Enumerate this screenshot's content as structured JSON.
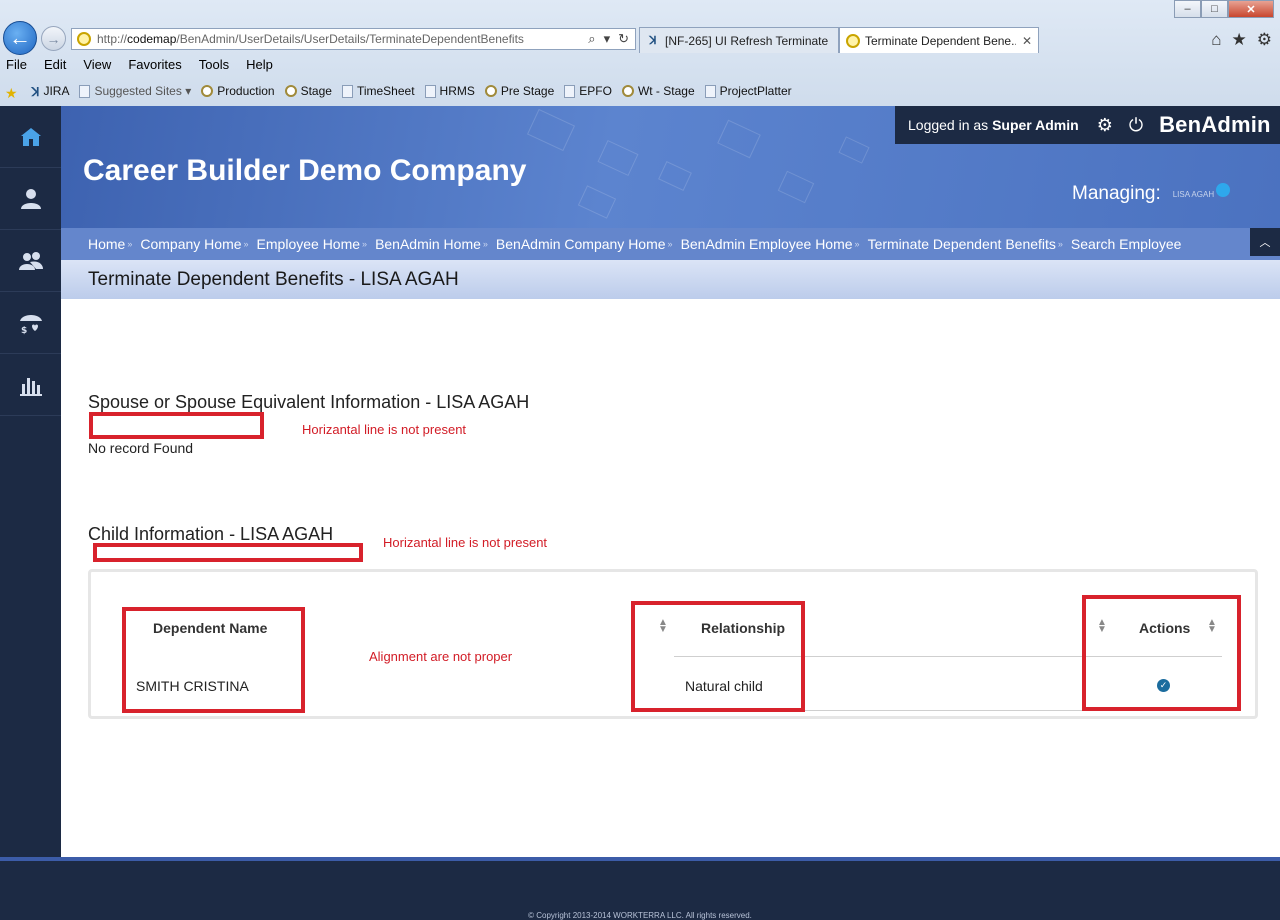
{
  "browser": {
    "address_prefix": "http://",
    "address_host": "codemap",
    "address_path": "/BenAdmin/UserDetails/UserDetails/TerminateDependentBenefits",
    "tabs": [
      {
        "label": "[NF-265] UI Refresh Terminate ...",
        "icon": "jira-icon"
      },
      {
        "label": "Terminate Dependent Bene...",
        "icon": "site-icon",
        "active": true
      }
    ],
    "menu": [
      "File",
      "Edit",
      "View",
      "Favorites",
      "Tools",
      "Help"
    ],
    "favorites": [
      "JIRA",
      "Suggested Sites",
      "Production",
      "Stage",
      "TimeSheet",
      "HRMS",
      "Pre Stage",
      "EPFO",
      "Wt - Stage",
      "ProjectPlatter"
    ]
  },
  "header": {
    "company": "Career Builder Demo Company",
    "logged_in_prefix": "Logged in as",
    "logged_in_user": "Super Admin",
    "brand": "BenAdmin",
    "managing_label": "Managing:",
    "managing_name": "LISA AGAH"
  },
  "breadcrumbs": [
    "Home",
    "Company Home",
    "Employee Home",
    "BenAdmin Home",
    "BenAdmin Company Home",
    "BenAdmin Employee Home",
    "Terminate Dependent Benefits",
    "Search Employee"
  ],
  "page_title": "Terminate Dependent Benefits - LISA AGAH",
  "spouse_section": {
    "title": "Spouse or Spouse Equivalent Information - LISA AGAH",
    "empty_text": "No record Found"
  },
  "child_section": {
    "title": "Child Information - LISA AGAH",
    "columns": [
      "Dependent Name",
      "Relationship",
      "Actions"
    ],
    "rows": [
      {
        "name": "SMITH CRISTINA",
        "relationship": "Natural child",
        "action_icon": "check-circle-icon"
      }
    ]
  },
  "annotations": {
    "spouse_note": "Horizantal line is not present",
    "child_note": "Horizantal line is not present",
    "table_note": "Alignment are not proper"
  },
  "footer": {
    "copyright": "© Copyright 2013-2014 WORKTERRA LLC. All rights reserved."
  },
  "colors": {
    "sidebar": "#1c2a44",
    "banner": "#4b72c0",
    "annotation_red": "#d8222c",
    "accent": "#2ea8ec"
  }
}
